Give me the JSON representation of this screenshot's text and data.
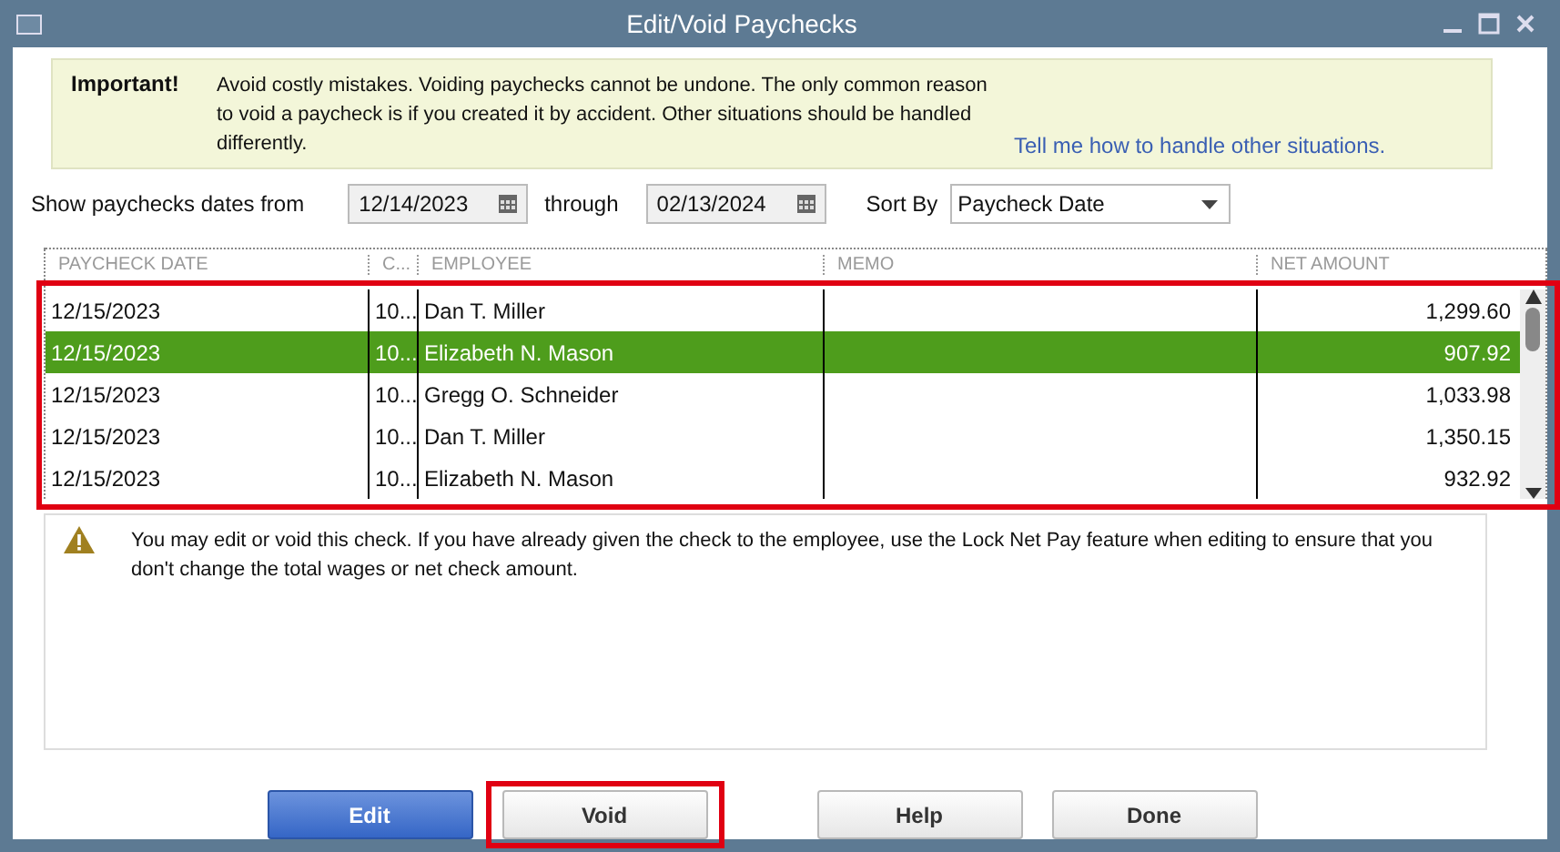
{
  "window": {
    "title": "Edit/Void Paychecks"
  },
  "notice": {
    "label": "Important!",
    "text": "Avoid costly mistakes. Voiding paychecks cannot be undone. The only common reason to void a paycheck is if you created it by accident. Other situations should be handled differently.",
    "link": "Tell me how to handle other situations."
  },
  "filters": {
    "from_label": "Show paychecks dates from",
    "from": "12/14/2023",
    "through_label": "through",
    "through": "02/13/2024",
    "sort_label": "Sort By",
    "sort": "Paycheck Date"
  },
  "table": {
    "highlighted": true,
    "columns": [
      "PAYCHECK DATE",
      "C...",
      "EMPLOYEE",
      "MEMO",
      "NET AMOUNT"
    ],
    "rows": [
      {
        "date": "12/15/2023",
        "check": "10...",
        "employee": "Dan T. Miller",
        "memo": "",
        "amount": "1,299.60",
        "selected": false
      },
      {
        "date": "12/15/2023",
        "check": "10...",
        "employee": "Elizabeth N. Mason",
        "memo": "",
        "amount": "907.92",
        "selected": true
      },
      {
        "date": "12/15/2023",
        "check": "10...",
        "employee": "Gregg O. Schneider",
        "memo": "",
        "amount": "1,033.98",
        "selected": false
      },
      {
        "date": "12/15/2023",
        "check": "10...",
        "employee": "Dan T. Miller",
        "memo": "",
        "amount": "1,350.15",
        "selected": false
      },
      {
        "date": "12/15/2023",
        "check": "10...",
        "employee": "Elizabeth N. Mason",
        "memo": "",
        "amount": "932.92",
        "selected": false
      }
    ]
  },
  "message": "You may edit or void this check. If you have already given the check to the employee, use the Lock Net Pay feature when editing to ensure that you don't change the total wages or net check amount.",
  "buttons": [
    {
      "label": "Edit",
      "kind": "primary",
      "highlighted": false
    },
    {
      "label": "Void",
      "kind": "normal",
      "highlighted": true
    },
    {
      "label": "Help",
      "kind": "normal",
      "highlighted": false
    },
    {
      "label": "Done",
      "kind": "normal",
      "highlighted": false
    }
  ]
}
